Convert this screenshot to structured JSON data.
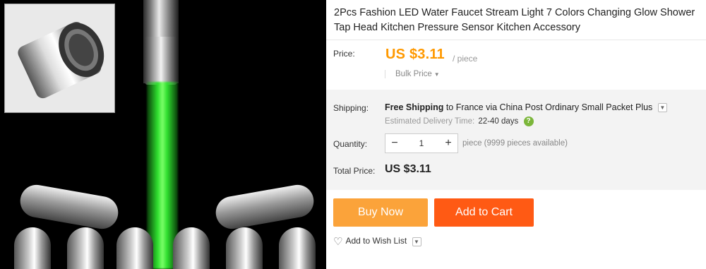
{
  "product": {
    "title": "2Pcs Fashion LED Water Faucet Stream Light 7 Colors Changing Glow Shower Tap Head Kitchen Pressure Sensor Kitchen Accessory"
  },
  "price": {
    "label": "Price:",
    "value": "US $3.11",
    "unit": "/ piece",
    "bulk_label": "Bulk Price"
  },
  "shipping": {
    "label": "Shipping:",
    "free_text": "Free Shipping",
    "to_text": "to France via China Post Ordinary Small Packet Plus",
    "delivery_label": "Estimated Delivery Time:",
    "delivery_value": "22-40 days",
    "help_glyph": "?"
  },
  "quantity": {
    "label": "Quantity:",
    "value": "1",
    "minus_glyph": "−",
    "plus_glyph": "+",
    "availability": "piece (9999 pieces available)"
  },
  "total": {
    "label": "Total Price:",
    "value": "US $3.11"
  },
  "actions": {
    "buy_now": "Buy Now",
    "add_to_cart": "Add to Cart",
    "wishlist": "Add to Wish List"
  },
  "colors": {
    "price_orange": "#ff9900",
    "buy_now_bg": "#fba33a",
    "add_to_cart_bg": "#ff5a14",
    "help_green": "#7bb63a"
  },
  "icons": {
    "dropdown": "chevron-down-icon",
    "help": "help-icon",
    "heart": "heart-plus-icon"
  }
}
